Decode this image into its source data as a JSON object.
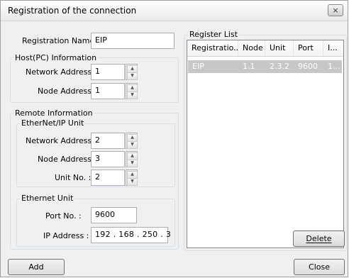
{
  "window": {
    "title": "Registration of the connection",
    "close_glyph": "×"
  },
  "registration": {
    "label": "Registration Name :",
    "value": "EIP"
  },
  "host": {
    "group_label": "Host(PC) Information",
    "network_label": "Network Address :",
    "network_value": "1",
    "node_label": "Node Address :",
    "node_value": "1"
  },
  "remote": {
    "group_label": "Remote Information",
    "eip_group_label": "EtherNet/IP Unit",
    "network_label": "Network Address :",
    "network_value": "2",
    "node_label": "Node Address :",
    "node_value": "3",
    "unit_label": "Unit No. :",
    "unit_value": "2",
    "eth_group_label": "Ethernet Unit",
    "port_label": "Port No. :",
    "port_value": "9600",
    "ip_label": "IP Address :",
    "ip_value": "192 . 168 . 250 .  3"
  },
  "register_list": {
    "label": "Register List",
    "columns": [
      "Registratio...",
      "Node",
      "Unit",
      "Port",
      "I..."
    ],
    "rows": [
      [
        "EIP",
        "1.1",
        "2.3.2",
        "9600",
        "1..."
      ]
    ]
  },
  "buttons": {
    "delete": "Delete",
    "add": "Add",
    "close": "Close"
  }
}
